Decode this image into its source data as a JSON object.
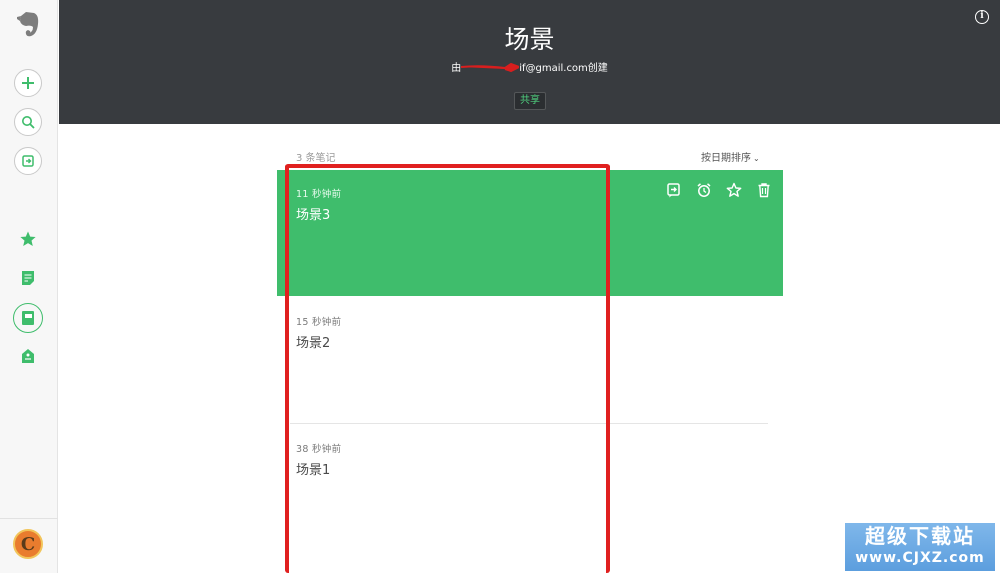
{
  "header": {
    "title": "场景",
    "subtitle_prefix": "由",
    "subtitle_email": "if@gmail.com",
    "subtitle_suffix": "创建",
    "share_label": "共享",
    "info_icon": "i"
  },
  "list": {
    "count_label": "3 条笔记",
    "sort_label": "按日期排序",
    "notes": [
      {
        "time": "11 秒钟前",
        "title": "场景3",
        "selected": true
      },
      {
        "time": "15 秒钟前",
        "title": "场景2",
        "selected": false
      },
      {
        "time": "38 秒钟前",
        "title": "场景1",
        "selected": false
      }
    ]
  },
  "sidebar": {
    "avatar_letter": "C"
  },
  "watermark": {
    "line1": "超级下载站",
    "line2": "www.CJXZ.com"
  },
  "colors": {
    "accent": "#3fbd6c",
    "header_bg": "#383b3f",
    "annotation": "#e0201f"
  }
}
